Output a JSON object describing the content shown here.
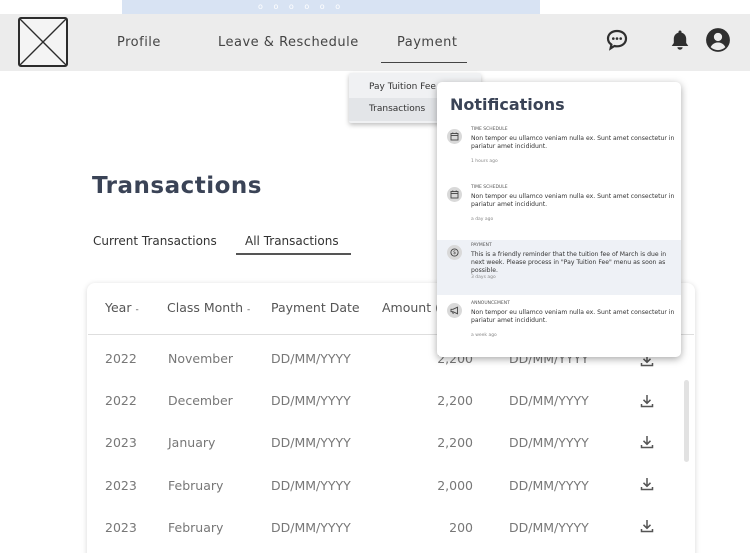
{
  "banner": {
    "decoration": "o o o o o o"
  },
  "nav": {
    "items": [
      {
        "label": "Profile"
      },
      {
        "label": "Leave & Reschedule"
      },
      {
        "label": "Payment"
      }
    ],
    "active": "Payment",
    "icons": [
      "chat-bubble-icon",
      "bell-icon",
      "user-profile-icon"
    ]
  },
  "dropdown": {
    "items": [
      {
        "label": "Pay Tuition Fee"
      },
      {
        "label": "Transactions"
      }
    ]
  },
  "page": {
    "title": "Transactions",
    "tabs": [
      {
        "label": "Current Transactions"
      },
      {
        "label": "All Transactions"
      }
    ],
    "active_tab": "All Transactions"
  },
  "table": {
    "headers": {
      "year": "Year",
      "class_month": "Class Month",
      "payment_date": "Payment Date",
      "amount": "Amount ("
    },
    "sortable_indicator": "-",
    "rows": [
      {
        "year": "2022",
        "month": "November",
        "payment_date": "DD/MM/YYYY",
        "amount": "2,200",
        "date2": "DD/MM/YYYY"
      },
      {
        "year": "2022",
        "month": "December",
        "payment_date": "DD/MM/YYYY",
        "amount": "2,200",
        "date2": "DD/MM/YYYY"
      },
      {
        "year": "2023",
        "month": "January",
        "payment_date": "DD/MM/YYYY",
        "amount": "2,200",
        "date2": "DD/MM/YYYY"
      },
      {
        "year": "2023",
        "month": "February",
        "payment_date": "DD/MM/YYYY",
        "amount": "2,000",
        "date2": "DD/MM/YYYY"
      },
      {
        "year": "2023",
        "month": "February",
        "payment_date": "DD/MM/YYYY",
        "amount": "200",
        "date2": "DD/MM/YYYY"
      }
    ],
    "row_action_icon": "download-icon"
  },
  "notifications": {
    "title": "Notifications",
    "items": [
      {
        "category": "Time Schedule",
        "icon": "calendar-icon",
        "text": "Non tempor eu ullamco veniam nulla ex. Sunt amet consectetur in pariatur amet incididunt.",
        "time": "1 hours ago"
      },
      {
        "category": "Time Schedule",
        "icon": "calendar-icon",
        "text": "Non tempor eu ullamco veniam nulla ex. Sunt amet consectetur in pariatur amet incididunt.",
        "time": "a day ago"
      },
      {
        "category": "Payment",
        "icon": "dollar-coin-icon",
        "text": "This is a friendly reminder that the tuition fee of March is due in next week.  Please process in \"Pay Tuition Fee\" menu as soon as possible.",
        "time": "3 days ago"
      },
      {
        "category": "Announcement",
        "icon": "megaphone-icon",
        "text": "Non tempor eu ullamco veniam nulla ex. Sunt amet consectetur in pariatur amet incididunt.",
        "time": "a week ago"
      }
    ]
  },
  "colors": {
    "header_bg": "#ececec",
    "title": "#3a4356",
    "highlight_row": "#eef1f6",
    "banner": "#d8e3f3"
  }
}
